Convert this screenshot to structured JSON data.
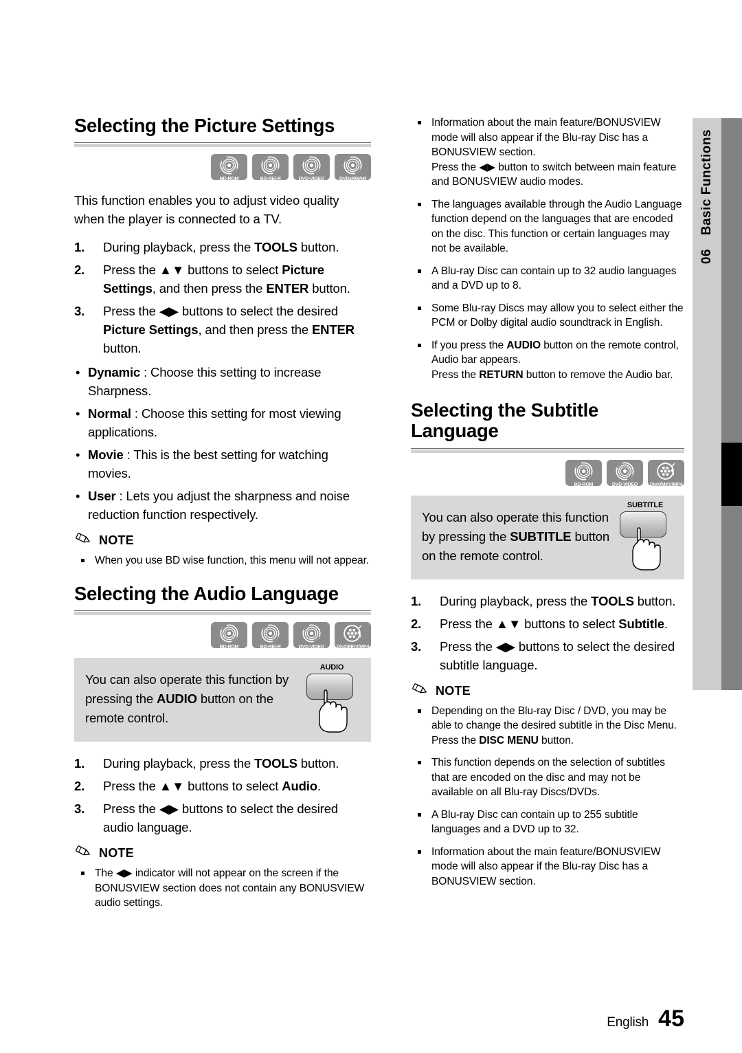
{
  "sidetab": {
    "number": "06",
    "label": "Basic Functions"
  },
  "footer": {
    "language": "English",
    "page": "45"
  },
  "note_label": "NOTE",
  "picture": {
    "title": "Selecting the Picture Settings",
    "badges": [
      {
        "icon": "disc-icon",
        "label": "BD-ROM"
      },
      {
        "icon": "disc-icon",
        "label": "BD-RE/-R"
      },
      {
        "icon": "disc-icon",
        "label": "DVD-VIDEO"
      },
      {
        "icon": "disc-icon",
        "label": "DVD±RW/±R"
      }
    ],
    "intro": "This function enables you to adjust video quality when the player is connected to a TV.",
    "steps": [
      {
        "num": "1.",
        "html": "During playback, press the <b>TOOLS</b> button."
      },
      {
        "num": "2.",
        "html": "Press the ▲▼ buttons to select <b>Picture Settings</b>, and then press the <b>ENTER</b> button."
      },
      {
        "num": "3.",
        "html": "Press the ◀▶ buttons to select the desired <b>Picture Settings</b>, and then press the <b>ENTER</b> button."
      }
    ],
    "options": [
      {
        "html": "<b>Dynamic</b> : Choose this setting to increase Sharpness."
      },
      {
        "html": "<b>Normal</b> : Choose this setting for most viewing applications."
      },
      {
        "html": "<b>Movie</b> : This is the best setting for watching movies."
      },
      {
        "html": "<b>User</b> : Lets you adjust the sharpness and noise reduction function respectively."
      }
    ],
    "notes": [
      {
        "html": "When you use BD wise function, this menu will not appear."
      }
    ]
  },
  "audio": {
    "title": "Selecting the Audio Language",
    "badges": [
      {
        "icon": "disc-icon",
        "label": "BD-ROM"
      },
      {
        "icon": "disc-icon",
        "label": "BD-RE/-R"
      },
      {
        "icon": "disc-icon",
        "label": "DVD-VIDEO"
      },
      {
        "icon": "film-reel-icon",
        "label": "DivX/MKV/MP4"
      }
    ],
    "callout": {
      "html": "You can also operate this function by pressing the <b>AUDIO</b> button on the remote control.",
      "remote_key": "AUDIO"
    },
    "steps": [
      {
        "num": "1.",
        "html": "During playback, press the <b>TOOLS</b> button."
      },
      {
        "num": "2.",
        "html": "Press the ▲▼ buttons to select <b>Audio</b>."
      },
      {
        "num": "3.",
        "html": "Press the ◀▶ buttons to select the desired audio language."
      }
    ],
    "notes": [
      {
        "html": "The ◀▶ indicator will not appear on the screen if the BONUSVIEW section does not contain any BONUSVIEW audio settings."
      }
    ],
    "notes_right": [
      {
        "html": "Information about the main feature/BONUSVIEW mode will also appear if the Blu-ray Disc has a BONUSVIEW section.",
        "sub": "Press the ◀▶ button to switch between main feature and BONUSVIEW audio modes."
      },
      {
        "html": "The languages available through the Audio Language function depend on the languages that are encoded on the disc. This function or certain languages may not be available."
      },
      {
        "html": "A Blu-ray Disc can contain up to 32 audio languages and a DVD up to 8."
      },
      {
        "html": "Some Blu-ray Discs may allow you to select either the PCM or Dolby digital audio soundtrack in English."
      },
      {
        "html": "If you press the <b>AUDIO</b> button on the remote control, Audio bar appears.",
        "sub": "Press the <b>RETURN</b> button to remove the Audio bar."
      }
    ]
  },
  "subtitle": {
    "title": "Selecting the Subtitle Language",
    "badges": [
      {
        "icon": "disc-icon",
        "label": "BD-ROM"
      },
      {
        "icon": "disc-icon",
        "label": "DVD-VIDEO"
      },
      {
        "icon": "film-reel-icon",
        "label": "DivX/MKV/MP4"
      }
    ],
    "callout": {
      "html": "You can also operate this function by pressing the <b>SUBTITLE</b> button on the remote control.",
      "remote_key": "SUBTITLE"
    },
    "steps": [
      {
        "num": "1.",
        "html": "During playback, press the <b>TOOLS</b> button."
      },
      {
        "num": "2.",
        "html": "Press the ▲▼ buttons to select <b>Subtitle</b>."
      },
      {
        "num": "3.",
        "html": "Press the ◀▶ buttons to select the desired subtitle language."
      }
    ],
    "notes": [
      {
        "html": "Depending on the Blu-ray Disc / DVD, you may be able to change the desired subtitle in the Disc Menu.",
        "sub": "Press the <b>DISC MENU</b> button."
      },
      {
        "html": "This function depends on the selection of subtitles that are encoded on the disc and may not be available on all Blu-ray Discs/DVDs."
      },
      {
        "html": "A Blu-ray Disc can contain up to 255 subtitle languages and a DVD up to 32."
      },
      {
        "html": "Information about the main feature/BONUSVIEW mode will also appear if the Blu-ray Disc has a BONUSVIEW section."
      }
    ]
  }
}
